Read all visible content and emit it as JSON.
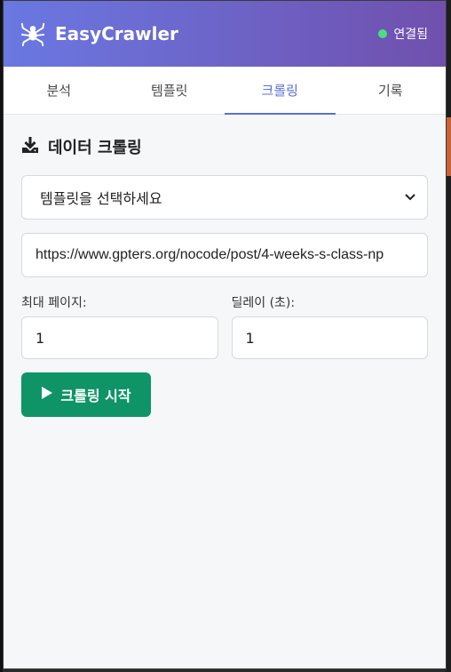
{
  "header": {
    "app_title": "EasyCrawler",
    "logo_icon": "spider-icon",
    "status_text": "연결됨",
    "status_color": "#4ade80",
    "gradient": [
      "#6a78e2",
      "#7050ad"
    ]
  },
  "tabs": [
    {
      "label": "분석",
      "active": false
    },
    {
      "label": "템플릿",
      "active": false
    },
    {
      "label": "크롤링",
      "active": true
    },
    {
      "label": "기록",
      "active": false
    }
  ],
  "crawl": {
    "section_title": "데이터 크롤링",
    "section_icon": "download-icon",
    "template_select": "템플릿을 선택하세요",
    "url_value": "https://www.gpters.org/nocode/post/4-weeks-s-class-np",
    "max_pages_label": "최대 페이지:",
    "max_pages_value": "1",
    "delay_label": "딜레이 (초):",
    "delay_value": "1",
    "start_button": "크롤링 시작",
    "start_button_color": "#0f9467"
  }
}
